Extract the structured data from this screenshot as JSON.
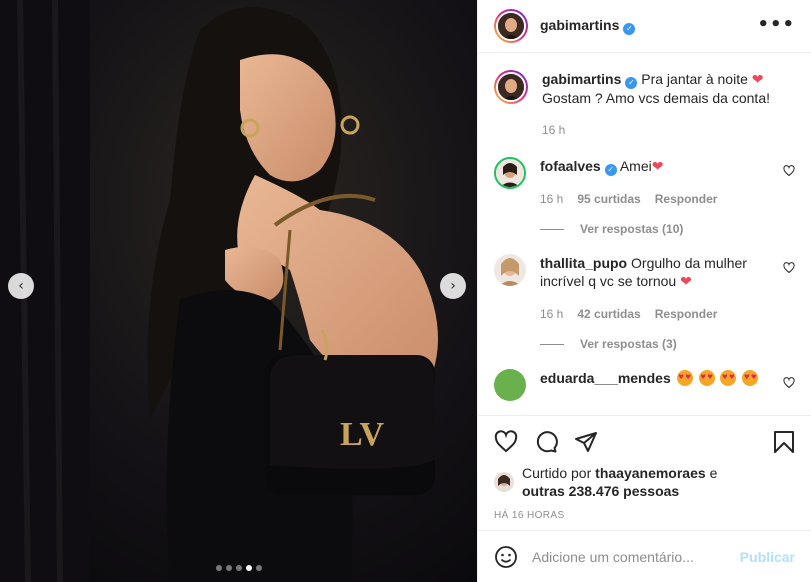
{
  "post": {
    "author": "gabimartins",
    "verified": true
  },
  "media": {
    "carousel": {
      "total": 5,
      "active_index": 3
    },
    "prev_symbol": "‹",
    "next_symbol": "›"
  },
  "header": {
    "username": "gabimartins",
    "more_symbol": "•••"
  },
  "caption": {
    "username": "gabimartins",
    "text": "Pra jantar à noite",
    "text2": "Gostam ? Amo vcs demais da conta!",
    "heart": "❤",
    "time": "16 h"
  },
  "comments": [
    {
      "username": "fofaalves",
      "verified": true,
      "text": "Amei",
      "heart": "❤",
      "time": "16 h",
      "likes": "95 curtidas",
      "reply": "Responder",
      "view_replies": "Ver respostas (10)"
    },
    {
      "username": "thallita_pupo",
      "verified": false,
      "text": "Orgulho da mulher incrível q vc se tornou",
      "heart": "❤",
      "time": "16 h",
      "likes": "42 curtidas",
      "reply": "Responder",
      "view_replies": "Ver respostas (3)"
    },
    {
      "username": "eduarda___mendes",
      "verified": false,
      "emoji_count": 4
    }
  ],
  "actions": {
    "liked_by_prefix": "Curtido por",
    "liked_by_user": "thaayanemoraes",
    "liked_by_connector": "e",
    "others": "outras 238.476 pessoas",
    "time_ago": "HÁ 16 HORAS"
  },
  "add_comment": {
    "placeholder": "Adicione um comentário...",
    "publish_label": "Publicar"
  },
  "colors": {
    "verified": "#3897f0",
    "heart": "#ed4956",
    "publish_disabled": "#b2dffc",
    "muted": "#8e8e8e"
  }
}
